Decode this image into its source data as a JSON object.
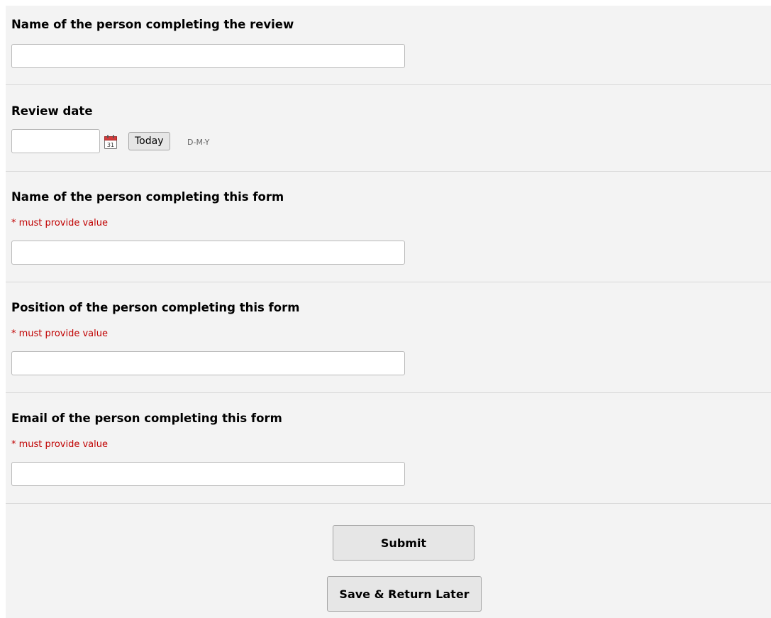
{
  "fields": {
    "review_name": {
      "label": "Name of the person completing the review",
      "value": ""
    },
    "review_date": {
      "label": "Review date",
      "value": "",
      "today_label": "Today",
      "format_hint": "D-M-Y",
      "calendar_icon": "calendar-icon"
    },
    "form_name": {
      "label": "Name of the person completing this form",
      "required_note": "* must provide value",
      "value": ""
    },
    "form_position": {
      "label": "Position of the person completing this form",
      "required_note": "* must provide value",
      "value": ""
    },
    "form_email": {
      "label": "Email of the person completing this form",
      "required_note": "* must provide value",
      "value": ""
    }
  },
  "actions": {
    "submit_label": "Submit",
    "save_return_label": "Save & Return Later"
  },
  "colors": {
    "panel_background": "#f3f3f3",
    "required_text": "#c00000",
    "button_background": "#e6e6e6"
  }
}
